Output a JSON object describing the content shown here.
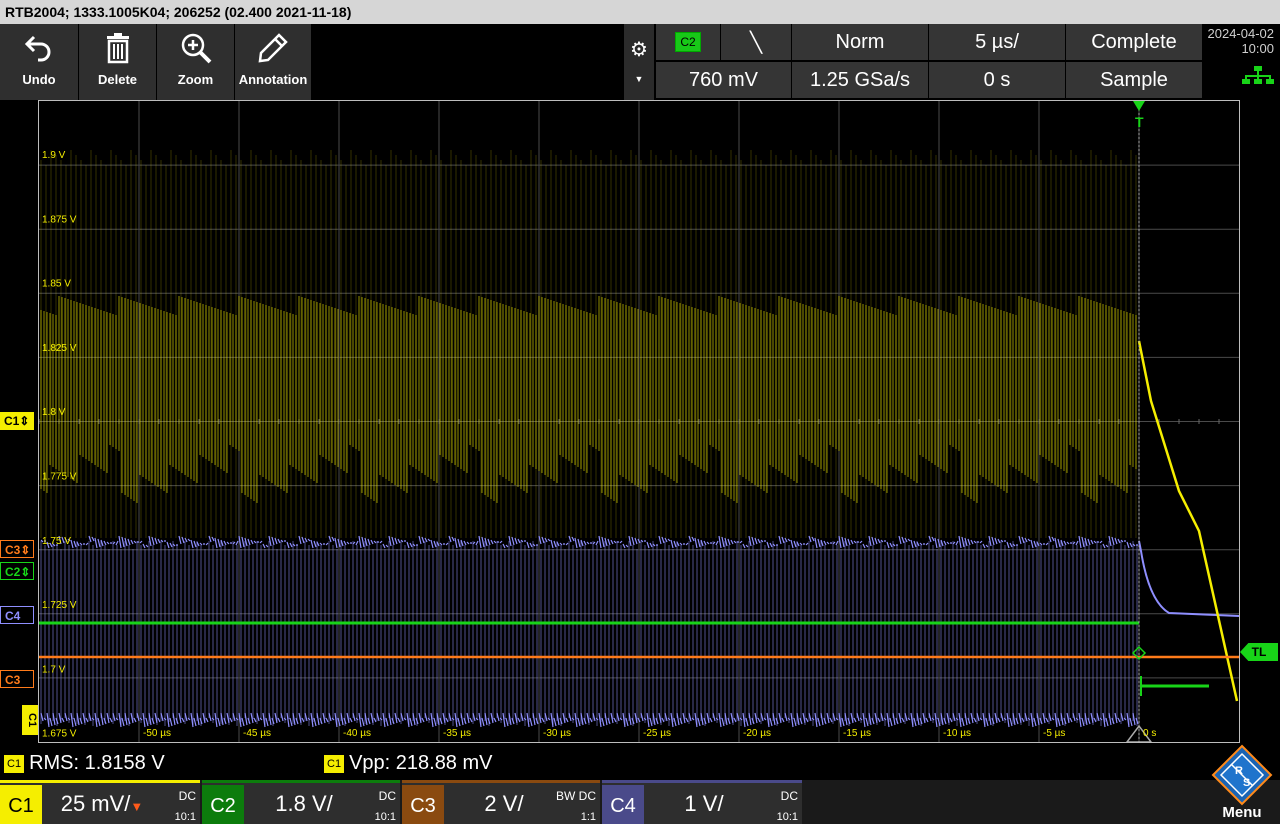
{
  "title_bar": "RTB2004; 1333.1005K04; 206252 (02.400 2021-11-18)",
  "toolbar": [
    {
      "label": "Undo",
      "icon": "undo-icon"
    },
    {
      "label": "Delete",
      "icon": "trash-icon"
    },
    {
      "label": "Zoom",
      "icon": "zoom-icon"
    },
    {
      "label": "Annotation",
      "icon": "pencil-icon"
    }
  ],
  "settings_icon": "gear-icon",
  "trigger": {
    "source": "C2",
    "slope_symbol": "╲",
    "mode": "Norm",
    "timebase": "5 µs/",
    "acq_status": "Complete",
    "level": "760 mV",
    "sample_rate": "1.25 GSa/s",
    "position": "0 s",
    "acq_mode": "Sample"
  },
  "datetime": {
    "date": "2024-04-02",
    "time": "10:00"
  },
  "network_icon": "lan-icon",
  "scope": {
    "y_labels": [
      "1.9 V",
      "1.875 V",
      "1.85 V",
      "1.825 V",
      "1.8 V",
      "1.775 V",
      "1.75 V",
      "1.725 V",
      "1.7 V",
      "1.675 V"
    ],
    "x_labels": [
      "-50 µs",
      "-45 µs",
      "-40 µs",
      "-35 µs",
      "-30 µs",
      "-25 µs",
      "-20 µs",
      "-15 µs",
      "-10 µs",
      "-5 µs",
      "0 s"
    ],
    "trigger_marker": "T",
    "trigger_level_marker": "TL",
    "channel_markers": [
      "C1",
      "C3",
      "C2",
      "C4",
      "C3"
    ],
    "side_label": "C1",
    "colors": {
      "C1": "#f5ee00",
      "C2": "#18d418",
      "C3": "#ff7b1a",
      "C4": "#8f8fff",
      "grid": "#4a4a4a"
    }
  },
  "measurements": [
    {
      "tag": "C1",
      "text": "RMS: 1.8158 V"
    },
    {
      "tag": "C1",
      "text": "Vpp: 218.88 mV"
    }
  ],
  "channels": [
    {
      "name": "C1",
      "scale": "25 mV/",
      "coupling": "DC",
      "probe": "10:1",
      "color": "#f5ee00"
    },
    {
      "name": "C2",
      "scale": "1.8 V/",
      "coupling": "DC",
      "probe": "10:1",
      "color": "#0c7c0c"
    },
    {
      "name": "C3",
      "scale": "2 V/",
      "coupling": "BW DC",
      "probe": "1:1",
      "color": "#8a4a10"
    },
    {
      "name": "C4",
      "scale": "1 V/",
      "coupling": "DC",
      "probe": "10:1",
      "color": "#4a4a8a"
    }
  ],
  "menu_label": "Menu",
  "logo_text": "R&S"
}
